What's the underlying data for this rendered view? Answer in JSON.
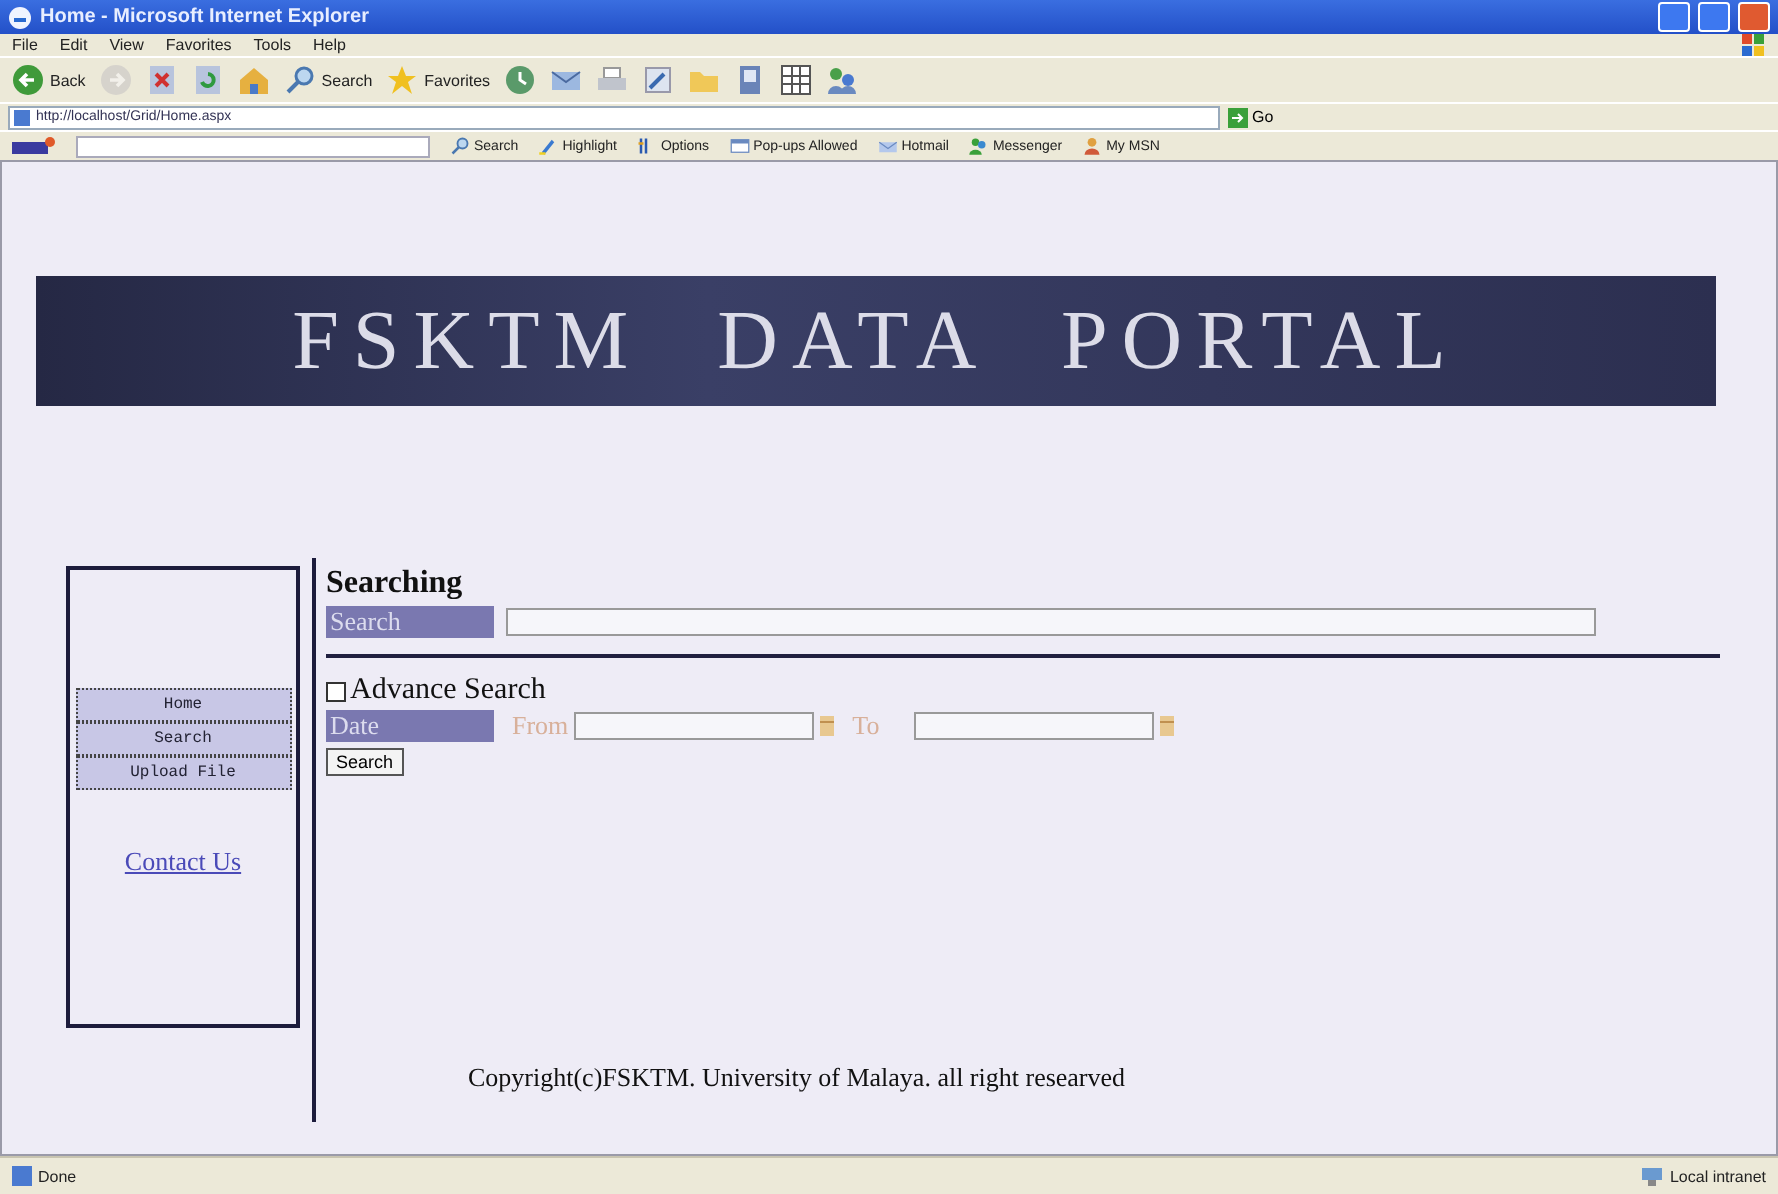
{
  "window": {
    "title": "Home - Microsoft Internet Explorer"
  },
  "menu": [
    "File",
    "Edit",
    "View",
    "Favorites",
    "Tools",
    "Help"
  ],
  "toolbar": [
    {
      "kind": "back",
      "label": "Back"
    },
    {
      "kind": "forward"
    },
    {
      "kind": "stop"
    },
    {
      "kind": "refresh"
    },
    {
      "kind": "home"
    },
    {
      "kind": "search",
      "label": "Search"
    },
    {
      "kind": "favorites",
      "label": "Favorites"
    },
    {
      "kind": "history"
    },
    {
      "kind": "mail"
    },
    {
      "kind": "print"
    },
    {
      "kind": "edit"
    },
    {
      "kind": "folder"
    },
    {
      "kind": "document"
    },
    {
      "kind": "grid"
    },
    {
      "kind": "people"
    }
  ],
  "address": {
    "url": "http://localhost/Grid/Home.aspx",
    "go": "Go"
  },
  "msn_bar": [
    {
      "kind": "search",
      "label": "Search"
    },
    {
      "kind": "highlight",
      "label": "Highlight"
    },
    {
      "kind": "options",
      "label": "Options"
    },
    {
      "kind": "popups",
      "label": "Pop-ups Allowed"
    },
    {
      "kind": "hotmail",
      "label": "Hotmail"
    },
    {
      "kind": "messenger",
      "label": "Messenger"
    },
    {
      "kind": "mymsn",
      "label": "My MSN"
    }
  ],
  "page": {
    "banner": "FSKTM DATA PORTAL",
    "nav": [
      "Home",
      "Search",
      "Upload File"
    ],
    "contact": "Contact Us",
    "heading": "Searching",
    "search_label": "Search",
    "advanced": {
      "label": "Advance Search",
      "checked": false
    },
    "date_label": "Date",
    "from_label": "From",
    "to_label": "To",
    "button": "Search",
    "copyright": "Copyright(c)FSKTM. University of Malaya. all right researved"
  },
  "status": {
    "text": "Done",
    "zone": "Local intranet"
  }
}
